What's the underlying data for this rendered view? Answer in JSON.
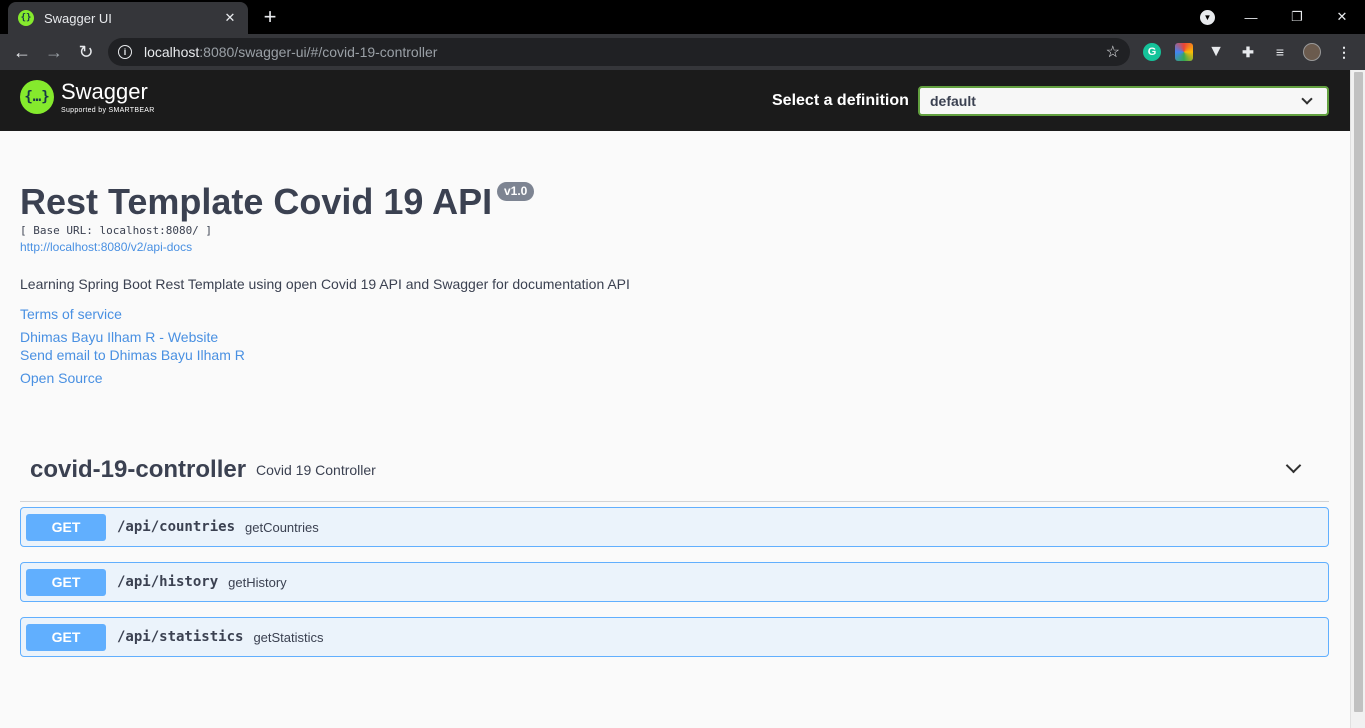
{
  "browser": {
    "tab_title": "Swagger UI",
    "url_host": "localhost",
    "url_rest": ":8080/swagger-ui/#/covid-19-controller"
  },
  "topbar": {
    "logo_name": "Swagger",
    "logo_sub": "Supported by SMARTBEAR",
    "definition_label": "Select a definition",
    "definition_value": "default"
  },
  "info": {
    "title": "Rest Template Covid 19 API",
    "version": "v1.0",
    "base_url": "[ Base URL: localhost:8080/ ]",
    "api_docs_url": "http://localhost:8080/v2/api-docs",
    "description": "Learning Spring Boot Rest Template using open Covid 19 API and Swagger for documentation API",
    "terms": "Terms of service",
    "contact_website": "Dhimas Bayu Ilham R - Website",
    "contact_email": "Send email to Dhimas Bayu Ilham R",
    "license": "Open Source"
  },
  "tag": {
    "name": "covid-19-controller",
    "description": "Covid 19 Controller"
  },
  "operations": [
    {
      "method": "GET",
      "path": "/api/countries",
      "summary": "getCountries"
    },
    {
      "method": "GET",
      "path": "/api/history",
      "summary": "getHistory"
    },
    {
      "method": "GET",
      "path": "/api/statistics",
      "summary": "getStatistics"
    }
  ]
}
